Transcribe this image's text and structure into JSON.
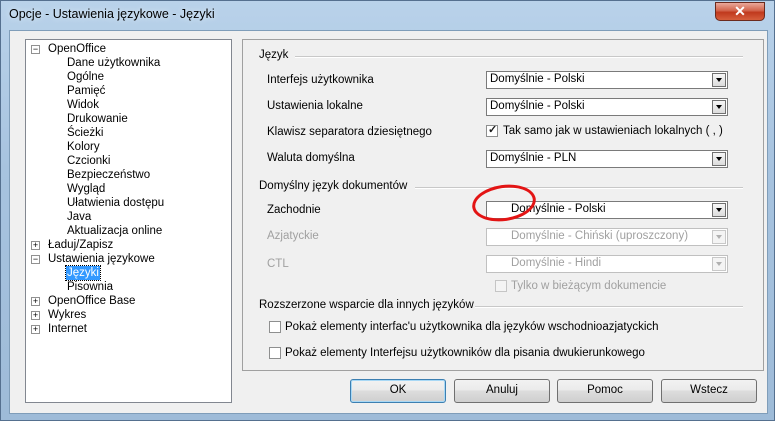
{
  "window": {
    "title": "Opcje - Ustawienia językowe - Języki",
    "close_glyph": "✕"
  },
  "tree": {
    "openoffice": "OpenOffice",
    "openoffice_children": [
      "Dane użytkownika",
      "Ogólne",
      "Pamięć",
      "Widok",
      "Drukowanie",
      "Ścieżki",
      "Kolory",
      "Czcionki",
      "Bezpieczeństwo",
      "Wygląd",
      "Ułatwienia dostępu",
      "Java",
      "Aktualizacja online"
    ],
    "load_save": "Ładuj/Zapisz",
    "lang_settings": "Ustawienia językowe",
    "lang_children": [
      "Języki",
      "Pisownia"
    ],
    "base": "OpenOffice Base",
    "charts": "Wykres",
    "internet": "Internet",
    "expand_glyph": "+",
    "collapse_glyph": "−"
  },
  "language": {
    "section_title": "Język",
    "ui_label": "Interfejs użytkownika",
    "ui_value": "Domyślnie - Polski",
    "locale_label": "Ustawienia lokalne",
    "locale_value": "Domyślnie - Polski",
    "decimal_label": "Klawisz separatora dziesiętnego",
    "decimal_check": "Tak samo jak w ustawieniach lokalnych ( , )",
    "currency_label": "Waluta domyślna",
    "currency_value": "Domyślnie - PLN"
  },
  "doc_lang": {
    "section_title": "Domyślny język dokumentów",
    "western_label": "Zachodnie",
    "western_value": "Domyślnie - Polski",
    "asian_label": "Azjatyckie",
    "asian_value": "Domyślnie - Chiński (uproszczony)",
    "ctl_label": "CTL",
    "ctl_value": "Domyślnie - Hindi",
    "current_doc_only": "Tylko w bieżącym dokumencie"
  },
  "enhanced": {
    "section_title": "Rozszerzone wsparcie dla innych języków",
    "asian_ui": "Pokaż elementy interfac'u użytkownika dla języków wschodnioazjatyckich",
    "ctl_ui": "Pokaż elementy Interfejsu użytkowników dla pisania dwukierunkowego"
  },
  "buttons": {
    "ok": "OK",
    "cancel": "Anuluj",
    "help": "Pomoc",
    "back": "Wstecz"
  }
}
